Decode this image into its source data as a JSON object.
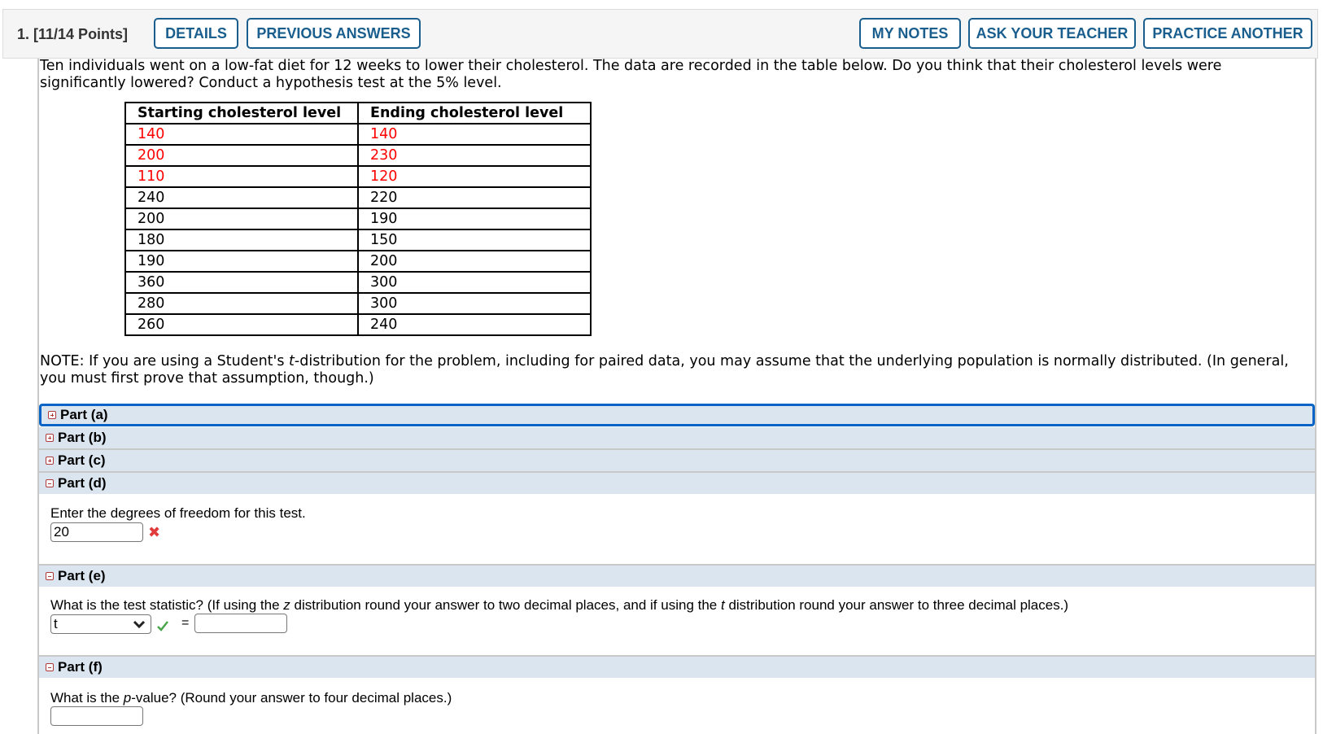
{
  "header": {
    "question_label": "1.  [11/14 Points]",
    "buttons": {
      "details": "DETAILS",
      "previous_answers": "PREVIOUS ANSWERS",
      "my_notes": "MY NOTES",
      "ask_teacher": "ASK YOUR TEACHER",
      "practice_another": "PRACTICE ANOTHER"
    },
    "accent_color": "#1a5e8e"
  },
  "problem": {
    "prompt": "Ten individuals went on a low-fat diet for 12 weeks to lower their cholesterol. The data are recorded in the table below. Do you think that their cholesterol levels were significantly lowered? Conduct a hypothesis test at the 5% level.",
    "table": {
      "headers": [
        "Starting cholesterol level",
        "Ending cholesterol level"
      ],
      "rows": [
        {
          "start": "140",
          "end": "140",
          "highlight": true
        },
        {
          "start": "200",
          "end": "230",
          "highlight": true
        },
        {
          "start": "110",
          "end": "120",
          "highlight": true
        },
        {
          "start": "240",
          "end": "220",
          "highlight": false
        },
        {
          "start": "200",
          "end": "190",
          "highlight": false
        },
        {
          "start": "180",
          "end": "150",
          "highlight": false
        },
        {
          "start": "190",
          "end": "200",
          "highlight": false
        },
        {
          "start": "360",
          "end": "300",
          "highlight": false
        },
        {
          "start": "280",
          "end": "300",
          "highlight": false
        },
        {
          "start": "260",
          "end": "240",
          "highlight": false
        }
      ],
      "highlight_color": "#ff0000"
    },
    "note_prefix": "NOTE: If you are using a Student's ",
    "note_italic": "t",
    "note_suffix": "-distribution for the problem, including for paired data, you may assume that the underlying population is normally distributed. (In general, you must first prove that assumption, though.)"
  },
  "parts": {
    "a": {
      "label": "Part (a)",
      "expanded": false
    },
    "b": {
      "label": "Part (b)",
      "expanded": false
    },
    "c": {
      "label": "Part (c)",
      "expanded": false
    },
    "d": {
      "label": "Part (d)",
      "expanded": true,
      "question": "Enter the degrees of freedom for this test.",
      "answer_value": "20",
      "status": "incorrect"
    },
    "e": {
      "label": "Part (e)",
      "expanded": true,
      "question_1": "What is the test statistic? (If using the ",
      "question_z": "z",
      "question_2": " distribution round your answer to two decimal places, and if using the ",
      "question_t": "t",
      "question_3": " distribution round your answer to three decimal places.)",
      "distribution_selected": "t",
      "distribution_status": "correct",
      "equals": "=",
      "answer_value": ""
    },
    "f": {
      "label": "Part (f)",
      "expanded": true,
      "question_1": "What is the ",
      "question_p": "p",
      "question_2": "-value? (Round your answer to four decimal places.)",
      "answer_value": ""
    }
  }
}
